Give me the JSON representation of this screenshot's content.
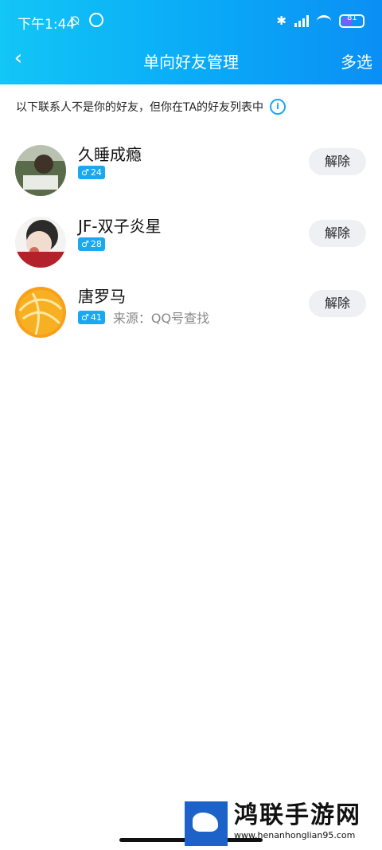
{
  "status": {
    "time": "下午1:44",
    "battery": "81"
  },
  "nav": {
    "back_icon": "chevron-left-icon",
    "title": "单向好友管理",
    "multi": "多选"
  },
  "notice": {
    "text": "以下联系人不是你的好友，但你在TA的好友列表中"
  },
  "contacts": [
    {
      "name": "久睡成瘾",
      "age": "24",
      "source": ""
    },
    {
      "name": "JF-双子炎星",
      "age": "28",
      "source": ""
    },
    {
      "name": "唐罗马",
      "age": "41",
      "source": "来源：QQ号查找"
    }
  ],
  "actions": {
    "remove": "解除"
  },
  "watermark": {
    "title": "鸿联手游网",
    "url": "www.henanhonglian95.com"
  }
}
